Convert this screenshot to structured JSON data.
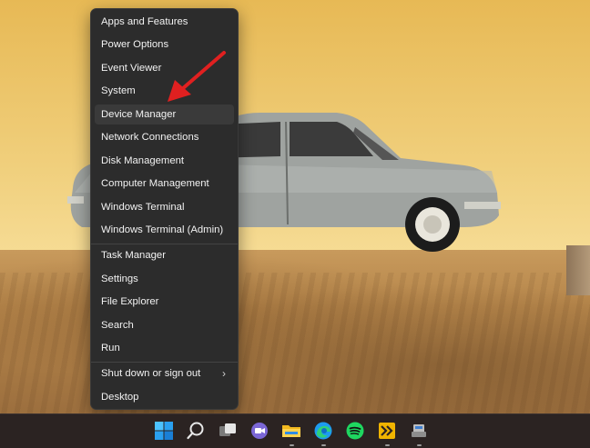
{
  "menu": {
    "items": [
      {
        "label": "Apps and Features"
      },
      {
        "label": "Power Options"
      },
      {
        "label": "Event Viewer"
      },
      {
        "label": "System"
      },
      {
        "label": "Device Manager"
      },
      {
        "label": "Network Connections"
      },
      {
        "label": "Disk Management"
      },
      {
        "label": "Computer Management"
      },
      {
        "label": "Windows Terminal"
      },
      {
        "label": "Windows Terminal (Admin)"
      },
      {
        "label": "Task Manager"
      },
      {
        "label": "Settings"
      },
      {
        "label": "File Explorer"
      },
      {
        "label": "Search"
      },
      {
        "label": "Run"
      },
      {
        "label": "Shut down or sign out",
        "submenu_glyph": "›"
      },
      {
        "label": "Desktop"
      }
    ],
    "highlighted": "Device Manager"
  },
  "taskbar": {
    "icons": [
      "start-icon",
      "search-icon",
      "task-view-icon",
      "chat-icon",
      "file-explorer-icon",
      "edge-icon",
      "spotify-icon",
      "app-icon",
      "device-icon"
    ]
  },
  "colors": {
    "menu_bg": "#2c2c2c",
    "highlight": "#3a3a3a",
    "arrow": "#e02020",
    "taskbar_bg": "#2b2322",
    "windows_blue": "#1d9bf0"
  }
}
